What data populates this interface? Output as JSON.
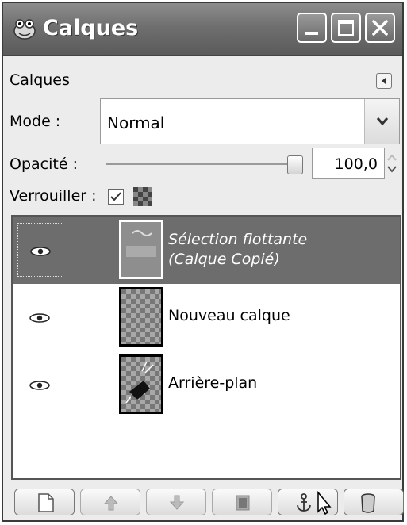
{
  "window": {
    "title": "Calques",
    "controls": [
      "minimize-icon",
      "maximize-icon",
      "close-icon"
    ]
  },
  "panel": {
    "tab_label": "Calques",
    "mode_label": "Mode :",
    "mode_value": "Normal",
    "opacity_label": "Opacité :",
    "opacity_value": "100,0",
    "opacity_fraction": 1.0,
    "lock_label": "Verrouiller :",
    "lock_checked": true
  },
  "layers": [
    {
      "line1": "Sélection flottante",
      "line2": "(Calque Copié)",
      "selected": true,
      "visible": true
    },
    {
      "name": "Nouveau calque",
      "selected": false,
      "visible": true
    },
    {
      "name": "Arrière-plan",
      "selected": false,
      "visible": true
    }
  ],
  "toolbar": {
    "buttons": [
      {
        "icon": "new-layer-icon",
        "enabled": true
      },
      {
        "icon": "raise-layer-icon",
        "enabled": false
      },
      {
        "icon": "lower-layer-icon",
        "enabled": false
      },
      {
        "icon": "duplicate-layer-icon",
        "enabled": false
      },
      {
        "icon": "anchor-icon",
        "enabled": true
      },
      {
        "icon": "trash-icon",
        "enabled": true
      }
    ]
  },
  "colors": {
    "titlebar": "#6f6f6f",
    "selection": "#6d6d6d",
    "panel_bg": "#ececec"
  }
}
